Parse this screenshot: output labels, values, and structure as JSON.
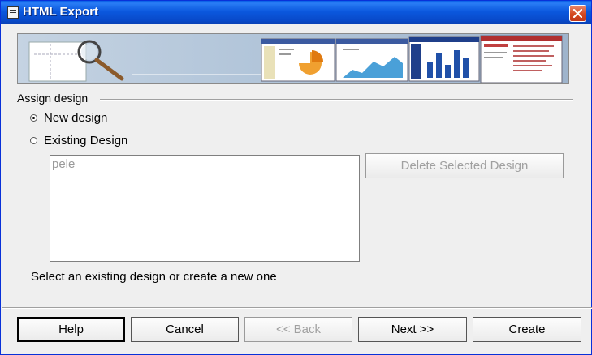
{
  "window": {
    "title": "HTML Export"
  },
  "assign": {
    "group_label": "Assign design",
    "new_design_label": "New design",
    "existing_design_label": "Existing Design",
    "selected": "new"
  },
  "designs": {
    "items": [
      "pele"
    ]
  },
  "delete_label": "Delete Selected Design",
  "hint": "Select an existing design or create a new one",
  "buttons": {
    "help": "Help",
    "cancel": "Cancel",
    "back": "<< Back",
    "next": "Next >>",
    "create": "Create"
  },
  "colors": {
    "titlebar": "#0b58de",
    "close": "#d4481f",
    "dialog_bg": "#efefef"
  }
}
